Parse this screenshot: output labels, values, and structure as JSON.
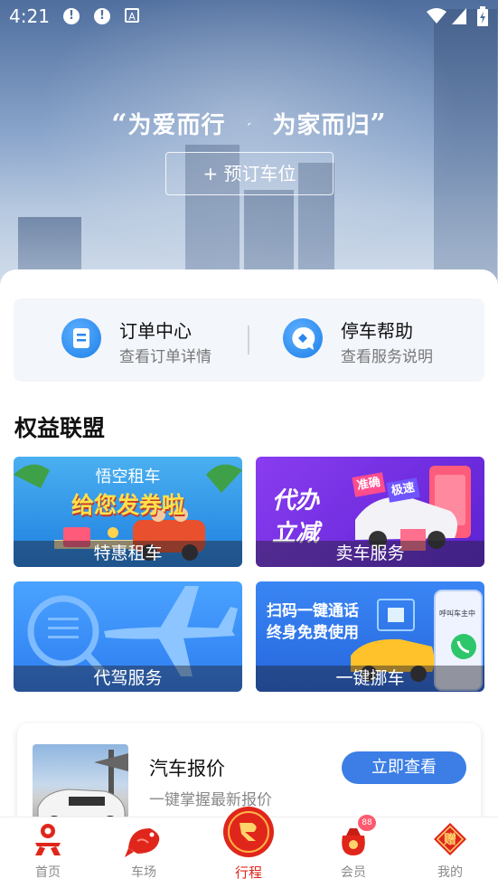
{
  "status_bar": {
    "time": "4:21",
    "notice_1": "!",
    "notice_2": "!",
    "app_badge": "A"
  },
  "hero": {
    "slogan_left": "为爱而行",
    "slogan_right": "为家而归",
    "reserve_button": "+ 预订车位"
  },
  "quick_links": [
    {
      "title": "订单中心",
      "subtitle": "查看订单详情",
      "icon": "document-icon"
    },
    {
      "title": "停车帮助",
      "subtitle": "查看服务说明",
      "icon": "chat-bubble-icon"
    }
  ],
  "section_title": "权益联盟",
  "cards": [
    {
      "caption": "特惠租车",
      "headline_1": "悟空租车",
      "headline_2": "给您发券啦",
      "colors": [
        "#4ab0f0",
        "#1e7fe0"
      ]
    },
    {
      "caption": "卖车服务",
      "headline_1": "代办",
      "headline_2": "立减",
      "tag_1": "准确",
      "tag_2": "极速",
      "colors": [
        "#8a3cf0",
        "#5b22d2"
      ]
    },
    {
      "caption": "代驾服务",
      "colors": [
        "#4aa3ff",
        "#2d7cf0"
      ]
    },
    {
      "caption": "一键挪车",
      "headline_1": "扫码一键通话",
      "headline_2": "终身免费使用",
      "phone_text": "呼叫车主中",
      "colors": [
        "#3a86f5",
        "#2566dc"
      ]
    }
  ],
  "price_card": {
    "title": "汽车报价",
    "subtitle": "一键掌握最新报价",
    "button": "立即查看"
  },
  "tabbar": {
    "items": [
      {
        "label": "首页",
        "icon": "home-knot-icon"
      },
      {
        "label": "车场",
        "icon": "fish-icon"
      },
      {
        "label": "行程",
        "icon": "koi-emblem-icon",
        "active": true
      },
      {
        "label": "会员",
        "icon": "lucky-bag-icon",
        "badge": "88"
      },
      {
        "label": "我的",
        "icon": "gift-diamond-icon",
        "glyph": "赠"
      }
    ],
    "active_color": "#e0261b",
    "inactive_color": "#8a8a8a"
  }
}
